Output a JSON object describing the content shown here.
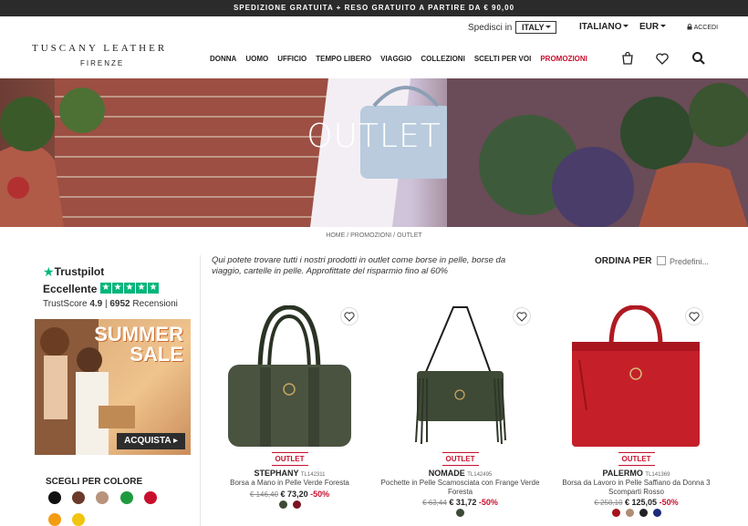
{
  "topbar": {
    "text": "SPEDIZIONE GRATUITA + RESO GRATUITO A PARTIRE DA € 90,00"
  },
  "util": {
    "ship_label": "Spedisci in",
    "country": "ITALY",
    "language": "ITALIANO",
    "currency": "EUR",
    "login": "ACCEDI"
  },
  "header": {
    "logo_main": "TUSCANY LEATHER",
    "logo_sub": "FIRENZE",
    "nav": [
      "DONNA",
      "UOMO",
      "UFFICIO",
      "TEMPO LIBERO",
      "VIAGGIO",
      "COLLEZIONI",
      "SCELTI PER VOI",
      "PROMOZIONI"
    ],
    "icons": [
      "bag-icon",
      "heart-icon",
      "search-icon"
    ]
  },
  "hero": {
    "title": "OUTLET"
  },
  "breadcrumb": "HOME / PROMOZIONI / OUTLET",
  "sidebar": {
    "trustpilot": {
      "brand": "Trustpilot",
      "rating_word": "Eccellente",
      "score_text": "TrustScore",
      "score": "4.9",
      "reviews_count": "6952",
      "reviews_label": "Recensioni"
    },
    "banner": {
      "line1": "SUMMER",
      "line2": "SALE",
      "cta": "ACQUISTA"
    },
    "colors_title": "SCEGLI PER COLORE",
    "colors": [
      "#111111",
      "#6b3a2a",
      "#b9937c",
      "#1f9a3e",
      "#c8102e",
      "#f39c12",
      "#f1c40f"
    ]
  },
  "main": {
    "intro": "Qui potete trovare tutti i nostri prodotti in outlet come borse in pelle, borse da viaggio, cartelle in pelle. Approfittate del risparmio fino al 60%",
    "sort_label": "ORDINA PER",
    "sort_value": "Predefini..."
  },
  "products": [
    {
      "badge": "OUTLET",
      "name": "STEPHANY",
      "code": "TL142311",
      "desc": "Borsa a Mano in Pelle Verde Foresta",
      "old_price": "€ 146,40",
      "new_price": "€ 73,20",
      "discount": "-50%",
      "colors": [
        "#3e4a35",
        "#7a1420"
      ]
    },
    {
      "badge": "OUTLET",
      "name": "NOMADE",
      "code": "TL142495",
      "desc": "Pochette in Pelle Scamosciata con Frange Verde Foresta",
      "old_price": "€ 63,44",
      "new_price": "€ 31,72",
      "discount": "-50%",
      "colors": [
        "#3e4a35"
      ]
    },
    {
      "badge": "OUTLET",
      "name": "PALERMO",
      "code": "TL141369",
      "desc": "Borsa da Lavoro in Pelle Saffiano da Donna 3 Scomparti Rosso",
      "old_price": "€ 250,10",
      "new_price": "€ 125,05",
      "discount": "-50%",
      "colors": [
        "#a3141c",
        "#b08c74",
        "#222222",
        "#1c2a7a"
      ]
    }
  ]
}
